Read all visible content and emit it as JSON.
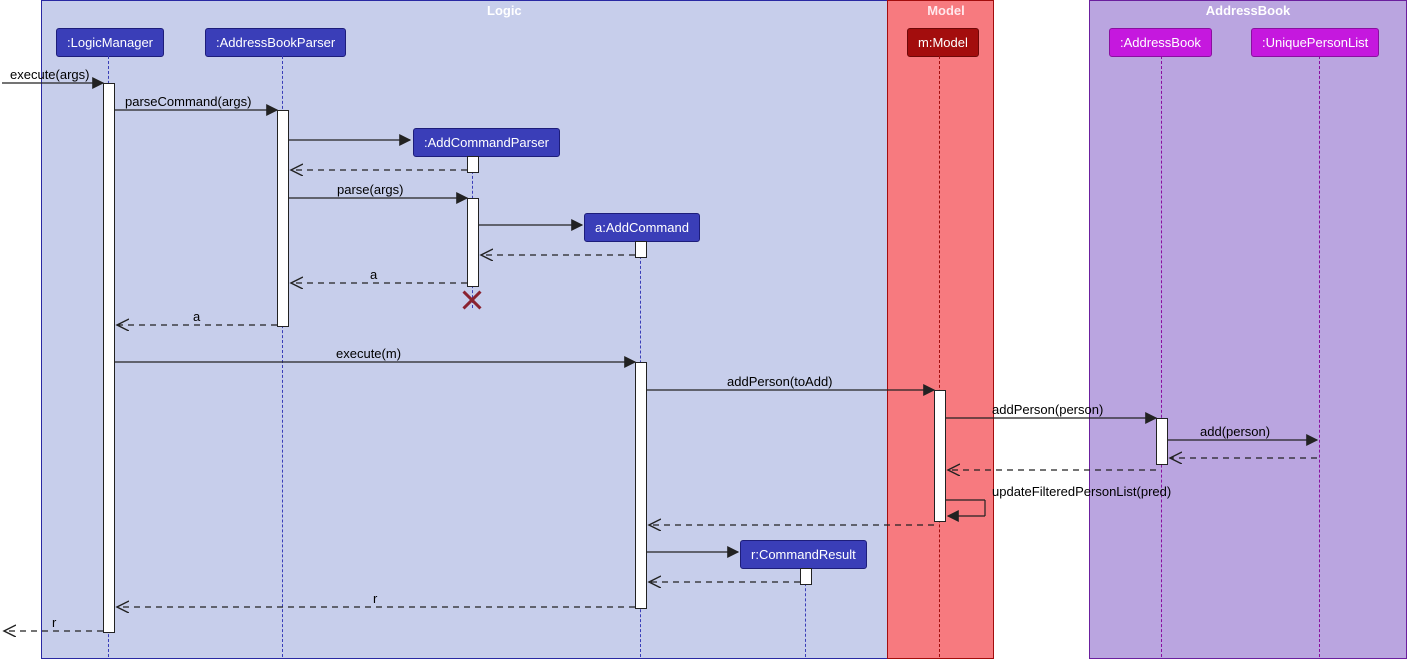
{
  "frames": {
    "logic": "Logic",
    "model": "Model",
    "addressbook": "AddressBook"
  },
  "participants": {
    "logicManager": ":LogicManager",
    "addressBookParser": ":AddressBookParser",
    "addCommandParser": ":AddCommandParser",
    "addCommand": "a:AddCommand",
    "commandResult": "r:CommandResult",
    "model": "m:Model",
    "addressBook": ":AddressBook",
    "uniquePersonList": ":UniquePersonList"
  },
  "messages": {
    "executeArgs": "execute(args)",
    "parseCommand": "parseCommand(args)",
    "parseArgs": "parse(args)",
    "retA1": "a",
    "retA2": "a",
    "executeM": "execute(m)",
    "addPersonToAdd": "addPerson(toAdd)",
    "addPersonPerson": "addPerson(person)",
    "addPerson": "add(person)",
    "updateFiltered": "updateFilteredPersonList(pred)",
    "retR1": "r",
    "retR2": "r"
  }
}
